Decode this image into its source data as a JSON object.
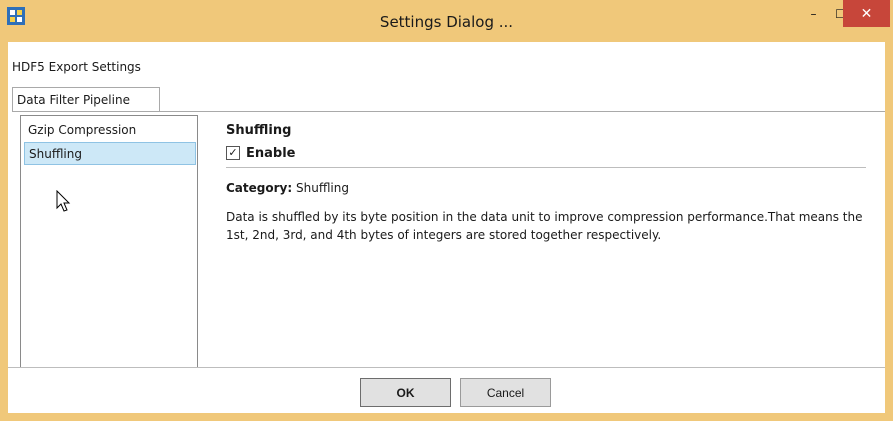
{
  "window": {
    "title": "Settings Dialog ...",
    "minimize_glyph": "–",
    "maximize_glyph": "☐",
    "close_glyph": "✕"
  },
  "section_title": "HDF5 Export Settings",
  "tabs": [
    {
      "label": "Data Filter Pipeline",
      "selected": true
    }
  ],
  "filters": {
    "items": [
      {
        "label": "Gzip Compression",
        "selected": false
      },
      {
        "label": "Shuffling",
        "selected": true
      }
    ]
  },
  "detail": {
    "title": "Shuffling",
    "enable_label": "Enable",
    "enable_checked": true,
    "check_glyph": "✓",
    "category_label": "Category:",
    "category_value": "Shuffling",
    "description": "Data is shuffled by its byte position in the data unit to improve compression performance.That means the 1st, 2nd, 3rd, and 4th bytes of integers are stored together respectively."
  },
  "buttons": {
    "ok": "OK",
    "cancel": "Cancel"
  },
  "colors": {
    "title_bar": "#f0c87a",
    "close_button": "#c7463a",
    "selection": "#cde8f7"
  },
  "icons": {
    "app": "app-icon",
    "cursor": "mouse-pointer-icon"
  }
}
